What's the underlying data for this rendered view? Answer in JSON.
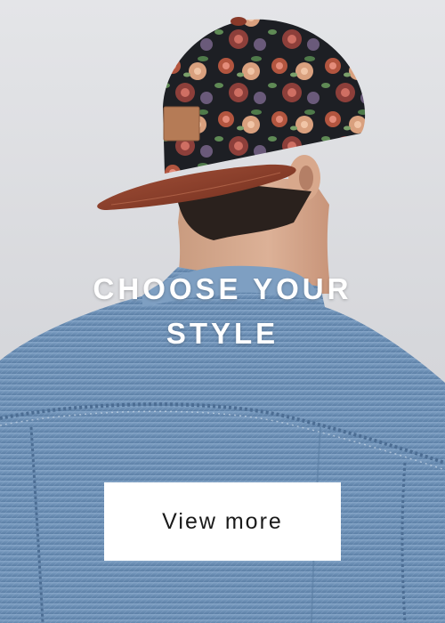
{
  "banner": {
    "headline_line1": "CHOOSE YOUR",
    "headline_line2": "STYLE",
    "cta_label": "View more"
  },
  "photo": {
    "subject": "person-back-view-icon",
    "items": [
      "floral-snapback-cap-icon",
      "denim-jacket-icon"
    ]
  },
  "colors": {
    "background": "#d7d8dc",
    "headline_text": "#ffffff",
    "cta_background": "#ffffff",
    "cta_text": "#1a1a1a",
    "denim": "#6f93b8",
    "cap_brim": "#8b3d28"
  }
}
